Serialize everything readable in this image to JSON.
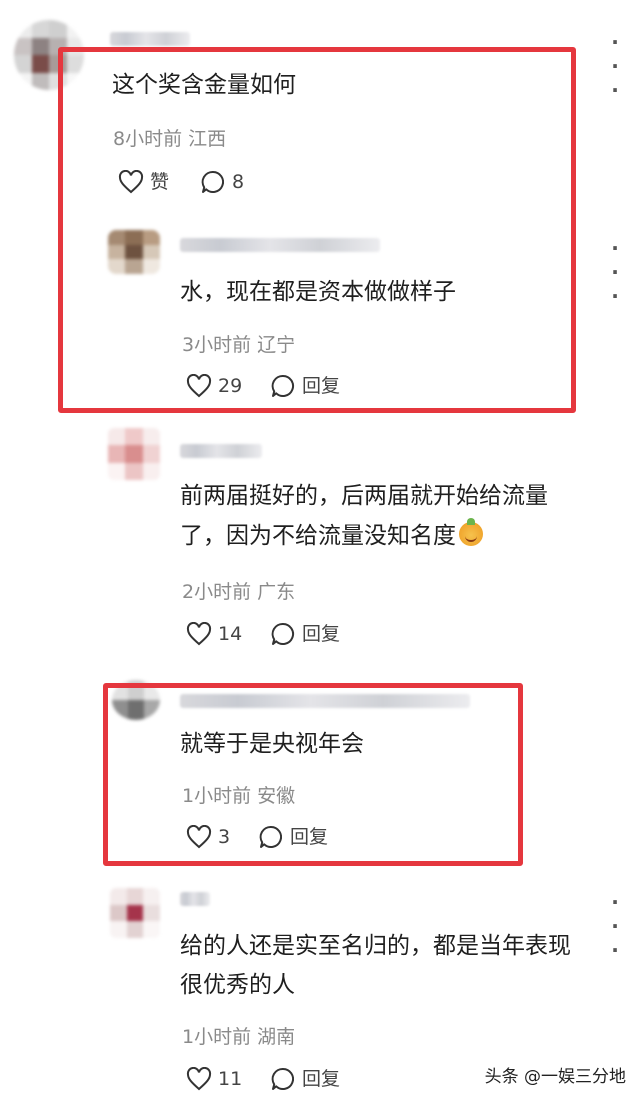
{
  "comments": [
    {
      "text": "这个奖含金量如何",
      "meta": "8小时前 江西",
      "like_label": "赞",
      "reply_count": "8"
    },
    {
      "text": "水，现在都是资本做做样子",
      "meta": "3小时前 辽宁",
      "like_count": "29",
      "reply_label": "回复"
    },
    {
      "text_line1": "前两届挺好的，后两届就开始给流量",
      "text_line2": "了，因为不给流量没知名度",
      "meta": "2小时前 广东",
      "like_count": "14",
      "reply_label": "回复"
    },
    {
      "text": "就等于是央视年会",
      "meta": "1小时前 安徽",
      "like_count": "3",
      "reply_label": "回复"
    },
    {
      "text_line1": "给的人还是实至名归的，都是当年表现",
      "text_line2": "很优秀的人",
      "meta": "1小时前 湖南",
      "like_count": "11",
      "reply_label": "回复"
    }
  ],
  "watermark": "头条 @一娱三分地",
  "colors": {
    "highlight": "#e5373e",
    "meta_text": "#8a8a8a"
  },
  "icons": [
    "heart-icon",
    "comment-bubble-icon",
    "more-options-icon",
    "emoji-icon"
  ]
}
